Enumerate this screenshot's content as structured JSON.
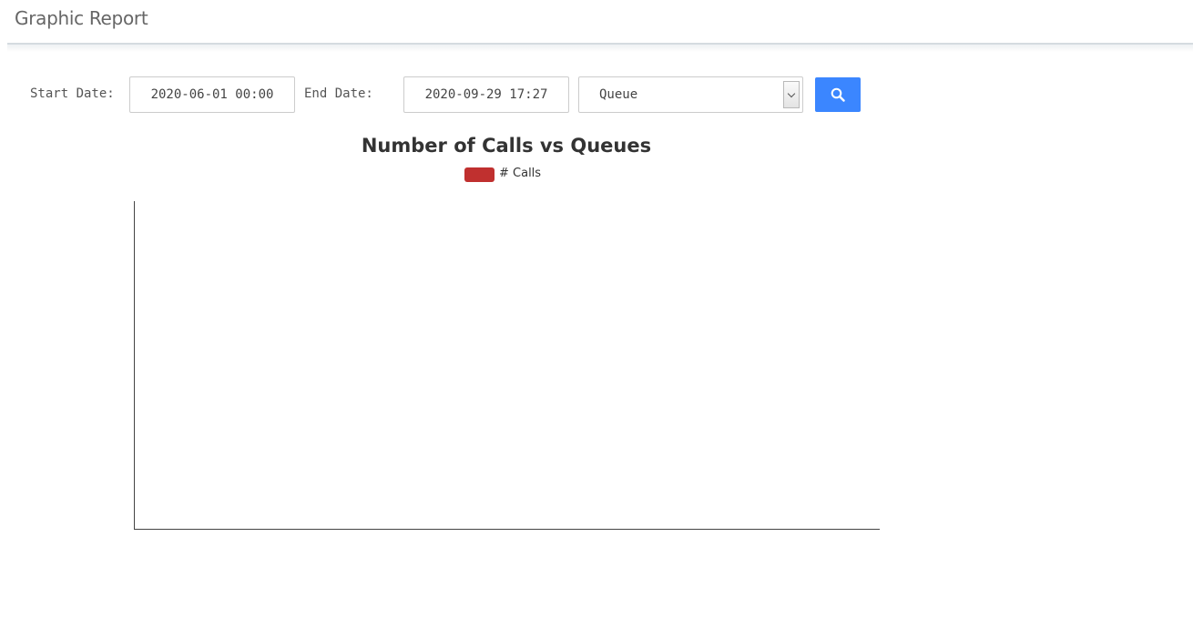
{
  "page": {
    "title": "Graphic Report"
  },
  "filters": {
    "start_label": "Start Date:",
    "start_value": "2020-06-01 00:00",
    "end_label": "End Date:",
    "end_value": "2020-09-29 17:27",
    "group_by": "Queue"
  },
  "chart_data": {
    "type": "bar",
    "title": "Number of Calls vs Queues",
    "categories": [],
    "series": [
      {
        "name": "# Calls",
        "values": [],
        "color": "#c0302f"
      }
    ],
    "xlabel": "",
    "ylabel": "",
    "legend": "top-center",
    "grid": false
  },
  "icons": {
    "search": "search-icon",
    "dropdown": "chevron-down-icon"
  }
}
